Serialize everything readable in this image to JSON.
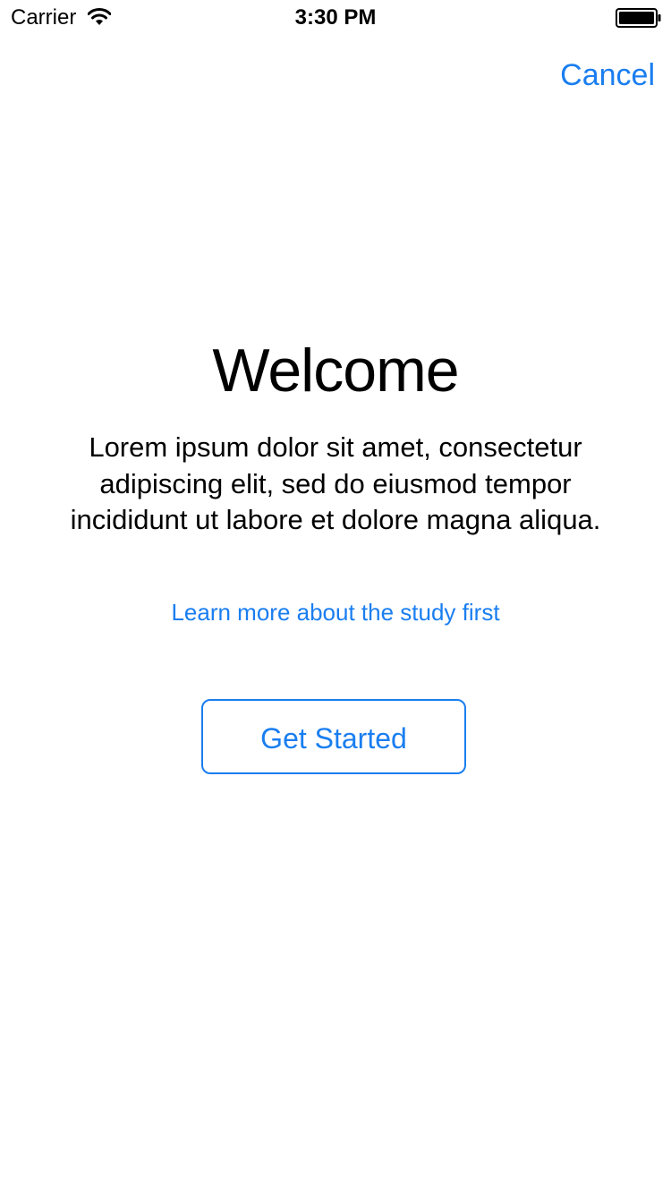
{
  "status_bar": {
    "carrier": "Carrier",
    "time": "3:30 PM",
    "wifi_icon": "wifi-icon",
    "battery_icon": "battery-icon"
  },
  "nav": {
    "cancel_label": "Cancel"
  },
  "main": {
    "title": "Welcome",
    "body": "Lorem ipsum dolor sit amet, consectetur adipiscing elit, sed do eiusmod tempor incididunt ut labore et dolore magna aliqua.",
    "learn_more_label": "Learn more about the study first",
    "get_started_label": "Get Started"
  },
  "colors": {
    "accent": "#1a7ef0",
    "background": "#ffffff",
    "text": "#000000"
  }
}
